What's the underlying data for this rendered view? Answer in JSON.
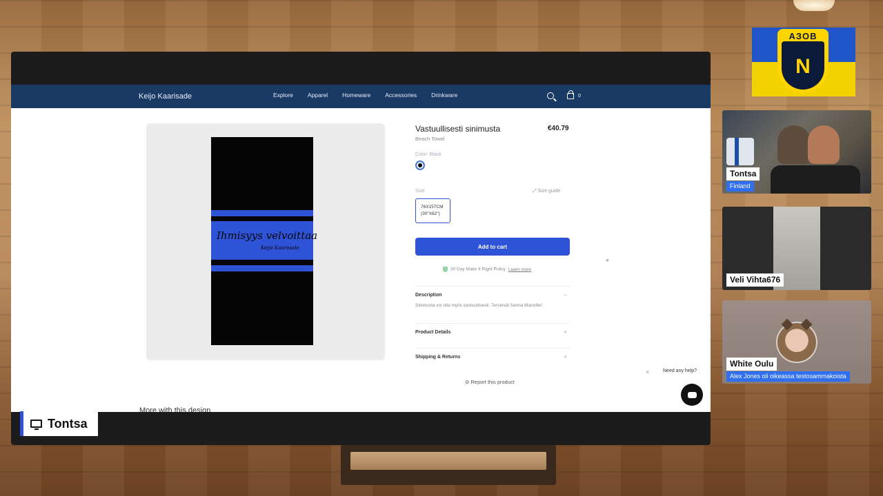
{
  "site": {
    "brand": "Keijo Kaarisade",
    "nav": [
      "Explore",
      "Apparel",
      "Homeware",
      "Accessories",
      "Drinkware"
    ],
    "cart_count": "0"
  },
  "product": {
    "title": "Vastuullisesti sinimusta",
    "price": "€40.79",
    "type": "Beach Towel",
    "color_label": "Color: Black",
    "size_label": "Size",
    "size_guide": "Size guide",
    "size_line1": "76X157CM",
    "size_line2": "(30\"X62\")",
    "add_to_cart": "Add to cart",
    "policy_text": "30 Day Make It Right Policy",
    "learn_more": "Learn more",
    "accordions": [
      {
        "title": "Description",
        "toggle": "−",
        "body": "Sinimusta voi olla myös vastuullisesti. Terveisiä Sanna Marinille!"
      },
      {
        "title": "Product Details",
        "toggle": "+"
      },
      {
        "title": "Shipping & Returns",
        "toggle": "+"
      }
    ],
    "report": "⊘ Report this product",
    "more_heading": "More with this design",
    "towel_print_title": "Ihmisyys velvoittaa",
    "towel_print_sub": "Keijo Kaarisade"
  },
  "help": {
    "close": "×",
    "text": "Need any help?"
  },
  "source": {
    "name": "Tontsa"
  },
  "badge": {
    "text": "AЗOB",
    "rune": "N"
  },
  "participants": [
    {
      "name": "Tontsa",
      "sub": "Finland"
    },
    {
      "name": "Veli Vihta676"
    },
    {
      "name": "White Oulu",
      "sub": "Alex Jones oli oikeassa testosammakoista"
    }
  ],
  "colors": {
    "nav": "#1a3a66",
    "accent": "#2f53d6",
    "stripe": "#2f53d6"
  },
  "icons": {
    "search": "search-icon",
    "cart": "cart-icon",
    "monitor": "monitor-icon",
    "chat": "chat-icon",
    "shield": "shield-icon"
  }
}
